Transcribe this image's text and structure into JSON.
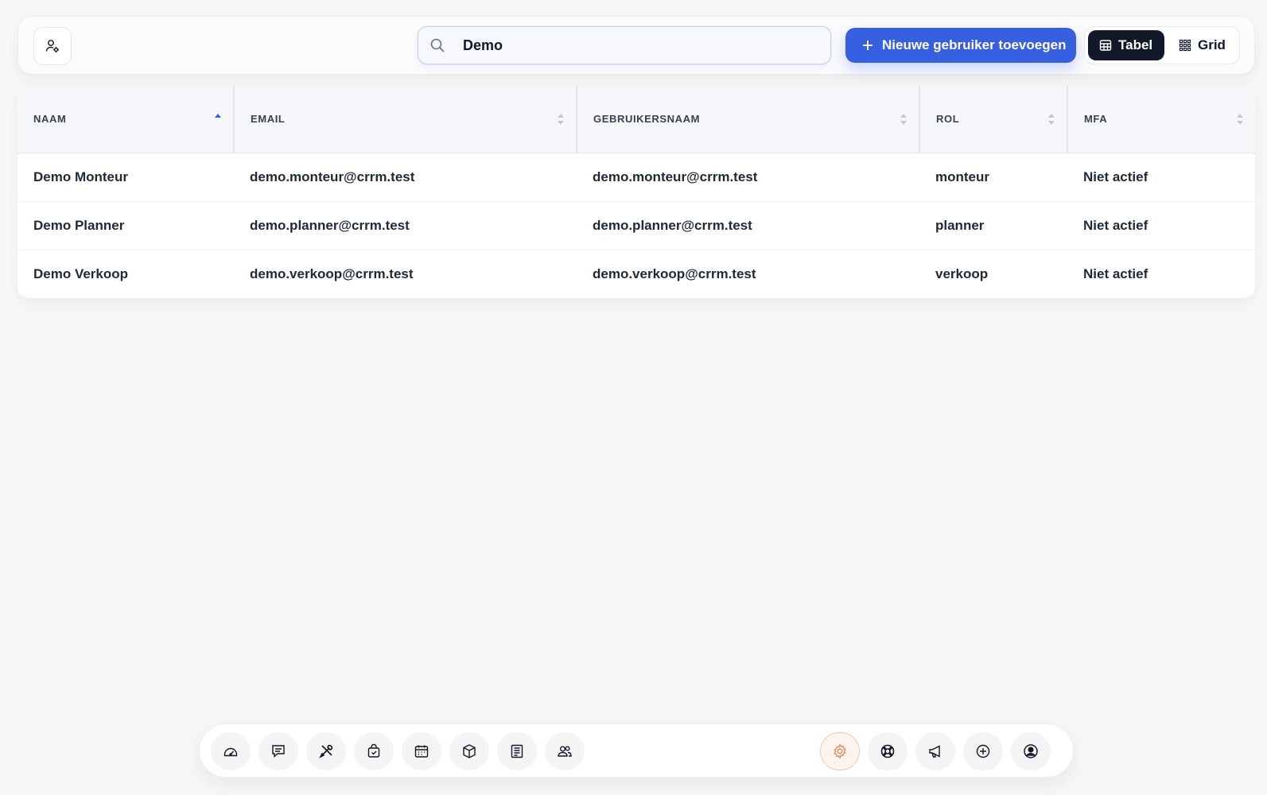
{
  "toolbar": {
    "search_value": "Demo",
    "add_user_label": "Nieuwe gebruiker toevoegen",
    "view_table_label": "Tabel",
    "view_grid_label": "Grid"
  },
  "table": {
    "columns": [
      "NAAM",
      "EMAIL",
      "GEBRUIKERSNAAM",
      "ROL",
      "MFA"
    ],
    "sorted_column": "NAAM",
    "sort_direction": "ascending",
    "rows": [
      {
        "naam": "Demo Monteur",
        "email": "demo.monteur@crrm.test",
        "gebruikersnaam": "demo.monteur@crrm.test",
        "rol": "monteur",
        "mfa": "Niet actief"
      },
      {
        "naam": "Demo Planner",
        "email": "demo.planner@crrm.test",
        "gebruikersnaam": "demo.planner@crrm.test",
        "rol": "planner",
        "mfa": "Niet actief"
      },
      {
        "naam": "Demo Verkoop",
        "email": "demo.verkoop@crrm.test",
        "gebruikersnaam": "demo.verkoop@crrm.test",
        "rol": "verkoop",
        "mfa": "Niet actief"
      }
    ]
  },
  "dock": {
    "items": [
      "dashboard-icon",
      "messages-icon",
      "tools-icon",
      "orders-icon",
      "calendar-icon",
      "box-icon",
      "invoice-icon",
      "users-icon",
      "settings-icon",
      "support-icon",
      "megaphone-icon",
      "plus-circle-icon",
      "profile-icon"
    ],
    "active_item": "settings-icon",
    "accent_color": "#e8895a"
  },
  "colors": {
    "primary": "#3660e0",
    "dark": "#111827",
    "sort_active": "#3660e0"
  }
}
